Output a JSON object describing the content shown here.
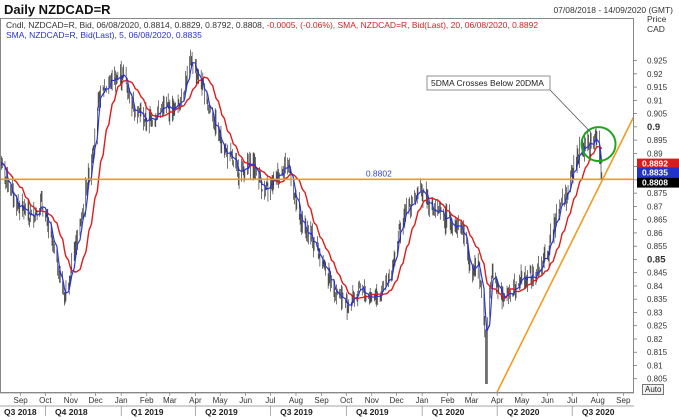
{
  "header": {
    "title": "Daily NZDCAD=R",
    "date_range": "07/08/2018 - 14/09/2020 (GMT)"
  },
  "legend": {
    "line1": {
      "candle": "Cndl, NZDCAD=R, Bid, 06/08/2020, 0.8814, 0.8829, 0.8792, 0.8808,",
      "change": "-0.0005, (-0.06%),",
      "sma": "SMA, NZDCAD=R, Bid(Last), 20, 06/08/2020, 0.8892"
    },
    "line2": {
      "sma": "SMA, NZDCAD=R, Bid(Last), 5, 06/08/2020, 0.8835"
    }
  },
  "axis_button": {
    "label": "Auto"
  },
  "colors": {
    "candles": "#1a1a1a",
    "sma5": "#2b35d6",
    "sma20": "#e01b1b",
    "trend": "#f39a1e",
    "support_label": "#3a46c8",
    "circle": "#1ea51e",
    "price_tag_black": "#000000",
    "price_tag_red": "#d61c1c",
    "price_tag_blue": "#2233cc"
  },
  "chart_data": {
    "type": "line",
    "instrument": "NZDCAD=R",
    "chart_style": "candlestick with moving averages",
    "y_axis_title": "Price",
    "y_axis_unit": "CAD",
    "ylim": [
      0.8,
      0.932
    ],
    "y_ticks": [
      0.805,
      0.81,
      0.815,
      0.82,
      0.825,
      0.83,
      0.835,
      0.84,
      0.845,
      0.85,
      0.855,
      0.86,
      0.865,
      0.87,
      0.875,
      0.88,
      0.885,
      0.89,
      0.895,
      0.9,
      0.905,
      0.91,
      0.915,
      0.92,
      0.925
    ],
    "y_tick_labels": [
      "0.805",
      "0.81",
      "0.815",
      "0.82",
      "0.825",
      "0.83",
      "0.835",
      "0.84",
      "0.845",
      "0.85",
      "0.855",
      "0.86",
      "0.865",
      "0.87",
      "0.875",
      "0.88",
      "0.885",
      "0.89",
      "0.895",
      "0.9",
      "0.905",
      "0.91",
      "0.915",
      "0.92",
      "0.925"
    ],
    "bold_y_ticks": [
      "0.85",
      "0.9"
    ],
    "x_start": "2018-08-07",
    "x_end": "2020-09-14",
    "month_ticks": [
      {
        "date": "2018-09-01",
        "label": "Sep"
      },
      {
        "date": "2018-10-01",
        "label": "Oct"
      },
      {
        "date": "2018-11-01",
        "label": "Nov"
      },
      {
        "date": "2018-12-01",
        "label": "Dec"
      },
      {
        "date": "2019-01-01",
        "label": "Jan"
      },
      {
        "date": "2019-02-01",
        "label": "Feb"
      },
      {
        "date": "2019-03-01",
        "label": "Mar"
      },
      {
        "date": "2019-04-01",
        "label": "Apr"
      },
      {
        "date": "2019-05-01",
        "label": "May"
      },
      {
        "date": "2019-06-01",
        "label": "Jun"
      },
      {
        "date": "2019-07-01",
        "label": "Jul"
      },
      {
        "date": "2019-08-01",
        "label": "Aug"
      },
      {
        "date": "2019-09-01",
        "label": "Sep"
      },
      {
        "date": "2019-10-01",
        "label": "Oct"
      },
      {
        "date": "2019-11-01",
        "label": "Nov"
      },
      {
        "date": "2019-12-01",
        "label": "Dec"
      },
      {
        "date": "2020-01-01",
        "label": "Jan"
      },
      {
        "date": "2020-02-01",
        "label": "Feb"
      },
      {
        "date": "2020-03-01",
        "label": "Mar"
      },
      {
        "date": "2020-04-01",
        "label": "Apr"
      },
      {
        "date": "2020-05-01",
        "label": "May"
      },
      {
        "date": "2020-06-01",
        "label": "Jun"
      },
      {
        "date": "2020-07-01",
        "label": "Jul"
      },
      {
        "date": "2020-08-01",
        "label": "Aug"
      },
      {
        "date": "2020-09-01",
        "label": "Sep"
      }
    ],
    "quarter_ticks": [
      {
        "date": "2018-08-07",
        "label": "Q3 2018"
      },
      {
        "date": "2018-10-01",
        "label": "Q4 2018"
      },
      {
        "date": "2019-01-01",
        "label": "Q1 2019"
      },
      {
        "date": "2019-04-01",
        "label": "Q2 2019"
      },
      {
        "date": "2019-07-01",
        "label": "Q3 2019"
      },
      {
        "date": "2019-10-01",
        "label": "Q4 2019"
      },
      {
        "date": "2020-01-01",
        "label": "Q1 2020"
      },
      {
        "date": "2020-04-01",
        "label": "Q2 2020"
      },
      {
        "date": "2020-07-01",
        "label": "Q3 2020"
      }
    ],
    "price_path": [
      {
        "date": "2018-08-07",
        "value": 0.887
      },
      {
        "date": "2018-08-25",
        "value": 0.872
      },
      {
        "date": "2018-09-12",
        "value": 0.866
      },
      {
        "date": "2018-09-26",
        "value": 0.871
      },
      {
        "date": "2018-10-08",
        "value": 0.858
      },
      {
        "date": "2018-10-24",
        "value": 0.836
      },
      {
        "date": "2018-11-12",
        "value": 0.862
      },
      {
        "date": "2018-11-26",
        "value": 0.889
      },
      {
        "date": "2018-12-06",
        "value": 0.912
      },
      {
        "date": "2018-12-18",
        "value": 0.917
      },
      {
        "date": "2019-01-03",
        "value": 0.92
      },
      {
        "date": "2019-01-15",
        "value": 0.908
      },
      {
        "date": "2019-02-01",
        "value": 0.902
      },
      {
        "date": "2019-02-20",
        "value": 0.907
      },
      {
        "date": "2019-03-10",
        "value": 0.907
      },
      {
        "date": "2019-03-28",
        "value": 0.925
      },
      {
        "date": "2019-04-12",
        "value": 0.913
      },
      {
        "date": "2019-05-01",
        "value": 0.895
      },
      {
        "date": "2019-05-22",
        "value": 0.883
      },
      {
        "date": "2019-06-10",
        "value": 0.886
      },
      {
        "date": "2019-06-25",
        "value": 0.875
      },
      {
        "date": "2019-07-10",
        "value": 0.882
      },
      {
        "date": "2019-07-22",
        "value": 0.887
      },
      {
        "date": "2019-08-05",
        "value": 0.865
      },
      {
        "date": "2019-08-25",
        "value": 0.855
      },
      {
        "date": "2019-09-12",
        "value": 0.842
      },
      {
        "date": "2019-10-01",
        "value": 0.833
      },
      {
        "date": "2019-10-18",
        "value": 0.838
      },
      {
        "date": "2019-11-01",
        "value": 0.836
      },
      {
        "date": "2019-11-20",
        "value": 0.84
      },
      {
        "date": "2019-12-05",
        "value": 0.862
      },
      {
        "date": "2019-12-20",
        "value": 0.873
      },
      {
        "date": "2020-01-03",
        "value": 0.876
      },
      {
        "date": "2020-01-15",
        "value": 0.868
      },
      {
        "date": "2020-02-01",
        "value": 0.865
      },
      {
        "date": "2020-02-18",
        "value": 0.862
      },
      {
        "date": "2020-03-01",
        "value": 0.846
      },
      {
        "date": "2020-03-10",
        "value": 0.848
      },
      {
        "date": "2020-03-18",
        "value": 0.82
      },
      {
        "date": "2020-03-26",
        "value": 0.845
      },
      {
        "date": "2020-04-10",
        "value": 0.835
      },
      {
        "date": "2020-04-28",
        "value": 0.843
      },
      {
        "date": "2020-05-15",
        "value": 0.843
      },
      {
        "date": "2020-06-01",
        "value": 0.852
      },
      {
        "date": "2020-06-12",
        "value": 0.868
      },
      {
        "date": "2020-06-25",
        "value": 0.875
      },
      {
        "date": "2020-07-08",
        "value": 0.89
      },
      {
        "date": "2020-07-20",
        "value": 0.893
      },
      {
        "date": "2020-07-30",
        "value": 0.896
      },
      {
        "date": "2020-08-06",
        "value": 0.8808
      }
    ],
    "last_candle": {
      "date": "2020-08-06",
      "open": 0.8814,
      "high": 0.8829,
      "low": 0.8792,
      "close": 0.8808
    },
    "sma5_last": 0.8835,
    "sma20_last": 0.8892,
    "support_level": 0.8802,
    "support_label": "0.8802",
    "trend_line": {
      "start": {
        "date": "2020-04-01",
        "value": 0.8
      },
      "end": {
        "date": "2020-09-14",
        "value": 0.904
      }
    },
    "circle_date": "2020-08-02",
    "circle_value": 0.8935,
    "annotation": "5DMA Crosses Below 20DMA",
    "price_tags": [
      "0.8892",
      "0.8835",
      "0.8808"
    ]
  }
}
